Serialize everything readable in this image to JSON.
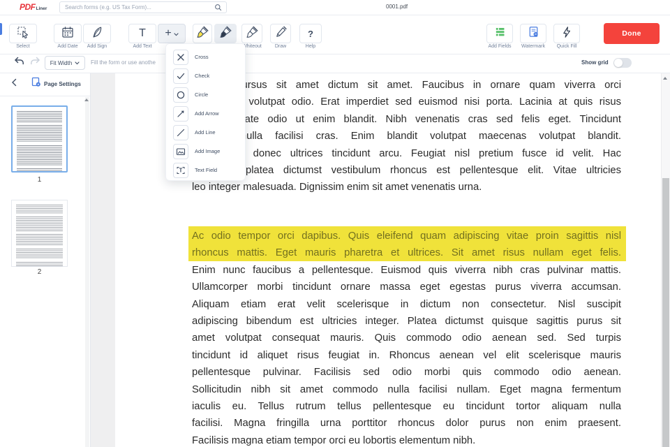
{
  "topbar": {
    "logo_pdf": "PDF",
    "logo_liner": "Liner",
    "search_placeholder": "Search forms (e.g. US Tax Form)...",
    "document_title": "0001.pdf"
  },
  "toolbar": {
    "select_label": "Select",
    "add_date_label": "Add Date",
    "add_sign_label": "Add Sign",
    "add_text_label": "Add Text",
    "whiteout_label": "Whiteout",
    "draw_label": "Draw",
    "help_label": "Help",
    "add_fields_label": "Add Fields",
    "watermark_label": "Watermark",
    "quick_fill_label": "Quick Fill",
    "done_label": "Done"
  },
  "insert_menu": {
    "items": [
      {
        "label": "Cross"
      },
      {
        "label": "Check"
      },
      {
        "label": "Circle"
      },
      {
        "label": "Add Arrow"
      },
      {
        "label": "Add Line"
      },
      {
        "label": "Add Image"
      },
      {
        "label": "Text Field"
      }
    ]
  },
  "controls": {
    "zoom_mode": "Fit Width",
    "hint_text": "Fill the form or use anothe",
    "show_grid_label": "Show grid",
    "show_grid_on": false
  },
  "sidebar": {
    "page_settings_label": "Page Settings",
    "pages": [
      {
        "number": "1",
        "selected": true
      },
      {
        "number": "2",
        "selected": false
      }
    ]
  },
  "document": {
    "paragraph1_lines": [
      "Pretium cursus sit amet dictum sit amet. Faucibus in ornare quam viverra orci",
      "sagittis eu volutpat odio. Erat imperdiet sed euismod nisi porta. Lacinia at quis risus",
      "sed vulputate odio ut enim blandit. Nibh venenatis cras sed felis eget. Tincidunt",
      "aliquam nulla facilisi cras. Enim blandit volutpat maecenas volutpat blandit.",
      "scelerisque donec ultrices tincidunt arcu. Feugiat nisl pretium fusce id velit. Hac",
      "habitasse platea dictumst vestibulum rhoncus est pellentesque elit. Vitae ultricies",
      "leo integer malesuada. Dignissim enim sit amet venenatis urna."
    ],
    "paragraph2_lines": [
      {
        "text": "Ac odio tempor orci dapibus. Quis eleifend quam adipiscing vitae proin sagittis nisl",
        "highlighted": true
      },
      {
        "text": "rhoncus mattis. Eget mauris pharetra et ultrices. Sit amet risus nullam eget felis.",
        "highlighted": true
      },
      {
        "text": "Enim nunc faucibus a pellentesque. Euismod quis viverra nibh cras pulvinar mattis.",
        "highlighted": false
      },
      {
        "text": "Ullamcorper morbi tincidunt ornare massa eget egestas purus viverra accumsan.",
        "highlighted": false
      },
      {
        "text": "Aliquam etiam erat velit scelerisque in dictum non consectetur. Nisl suscipit",
        "highlighted": false
      },
      {
        "text": "adipiscing bibendum est ultricies integer. Platea dictumst quisque sagittis purus sit",
        "highlighted": false
      },
      {
        "text": "amet volutpat consequat mauris. Quis commodo odio aenean sed. Sed turpis",
        "highlighted": false
      },
      {
        "text": "tincidunt id aliquet risus feugiat in. Rhoncus aenean vel elit scelerisque mauris",
        "highlighted": false
      },
      {
        "text": "pellentesque pulvinar. Facilisis sed odio morbi quis commodo odio aenean.",
        "highlighted": false
      },
      {
        "text": "Sollicitudin nibh sit amet commodo nulla facilisi nullam. Eget magna fermentum",
        "highlighted": false
      },
      {
        "text": "iaculis eu. Tellus rutrum tellus pellentesque eu tincidunt tortor aliquam nulla",
        "highlighted": false
      },
      {
        "text": "facilisi. Magna fringilla urna porttitor rhoncus dolor purus non enim praesent.",
        "highlighted": false
      },
      {
        "text": "Facilisis magna etiam tempor orci eu lobortis elementum nibh.",
        "highlighted": false
      }
    ]
  },
  "colors": {
    "accent_red": "#f4433c",
    "brand_red": "#e8353c",
    "link_blue": "#4a7de0",
    "fields_green": "#57c06a",
    "highlight_yellow": "#f0e23a",
    "selected_thumb_border": "#79aee9"
  }
}
